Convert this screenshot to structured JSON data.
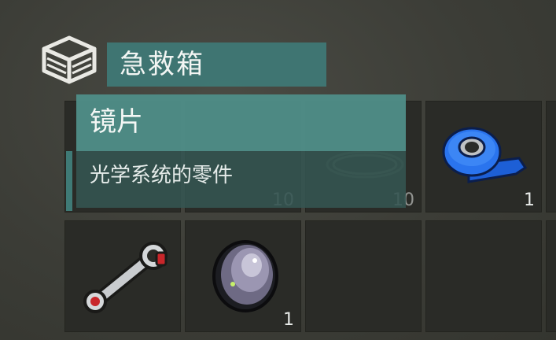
{
  "container": {
    "title": "急救箱",
    "icon": "storage-box-icon"
  },
  "tooltip": {
    "name": "镜片",
    "description": "光学系统的零件"
  },
  "slots": [
    {
      "item": "hidden-item",
      "count": ""
    },
    {
      "item": "hidden-item",
      "count": "10"
    },
    {
      "item": "wire-coil",
      "count": "10"
    },
    {
      "item": "blue-duct-tape",
      "count": "1"
    },
    {
      "item": "connecting-rod",
      "count": ""
    },
    {
      "item": "lens",
      "count": "1"
    },
    {
      "item": "",
      "count": ""
    },
    {
      "item": "",
      "count": ""
    }
  ],
  "colors": {
    "accent": "#3f7a76",
    "tooltip_header": "#4e8c86",
    "slot_bg": "#2a2b27"
  }
}
